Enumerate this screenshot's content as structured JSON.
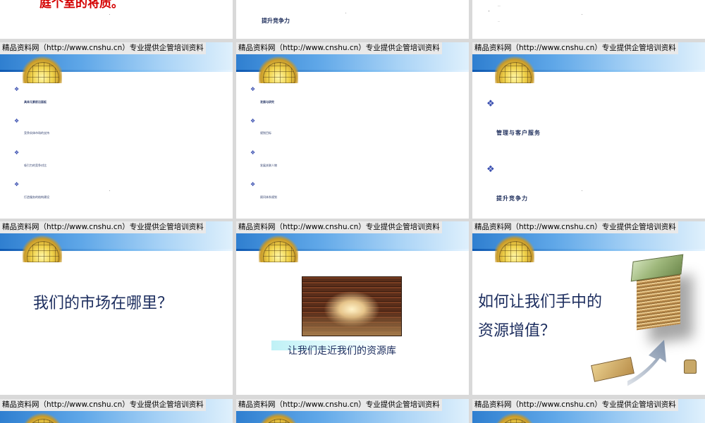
{
  "banner": {
    "label": "精品资料网（http://www.cnshu.cn）专业提供企管培训资料"
  },
  "row0": {
    "s0": {
      "title": "庭个室的将质。"
    },
    "s1": {
      "text": "提升竞争力"
    },
    "s2": {
      "line1": "---",
      "line2": "..."
    }
  },
  "row1": {
    "s0": {
      "items": [
        "具体元素前沿面板",
        "竞争实体市场的支持",
        "吸引力的竞争对比",
        "打造服务的结构建设"
      ]
    },
    "s1": {
      "items": [
        "发展与研究",
        "规划目标",
        "发展关联人物",
        "顾问体系规划"
      ]
    },
    "s2": {
      "items": [
        "管理与客户服务",
        "提升竞争力"
      ]
    }
  },
  "row2": {
    "s0": {
      "title": "我们的市场在哪里？"
    },
    "s1": {
      "caption": "让我们走近我们的资源库"
    },
    "s2": {
      "line1": "如何让我们手中的",
      "line2": "资源增值？"
    }
  },
  "icons": {
    "bullet": "❖"
  }
}
